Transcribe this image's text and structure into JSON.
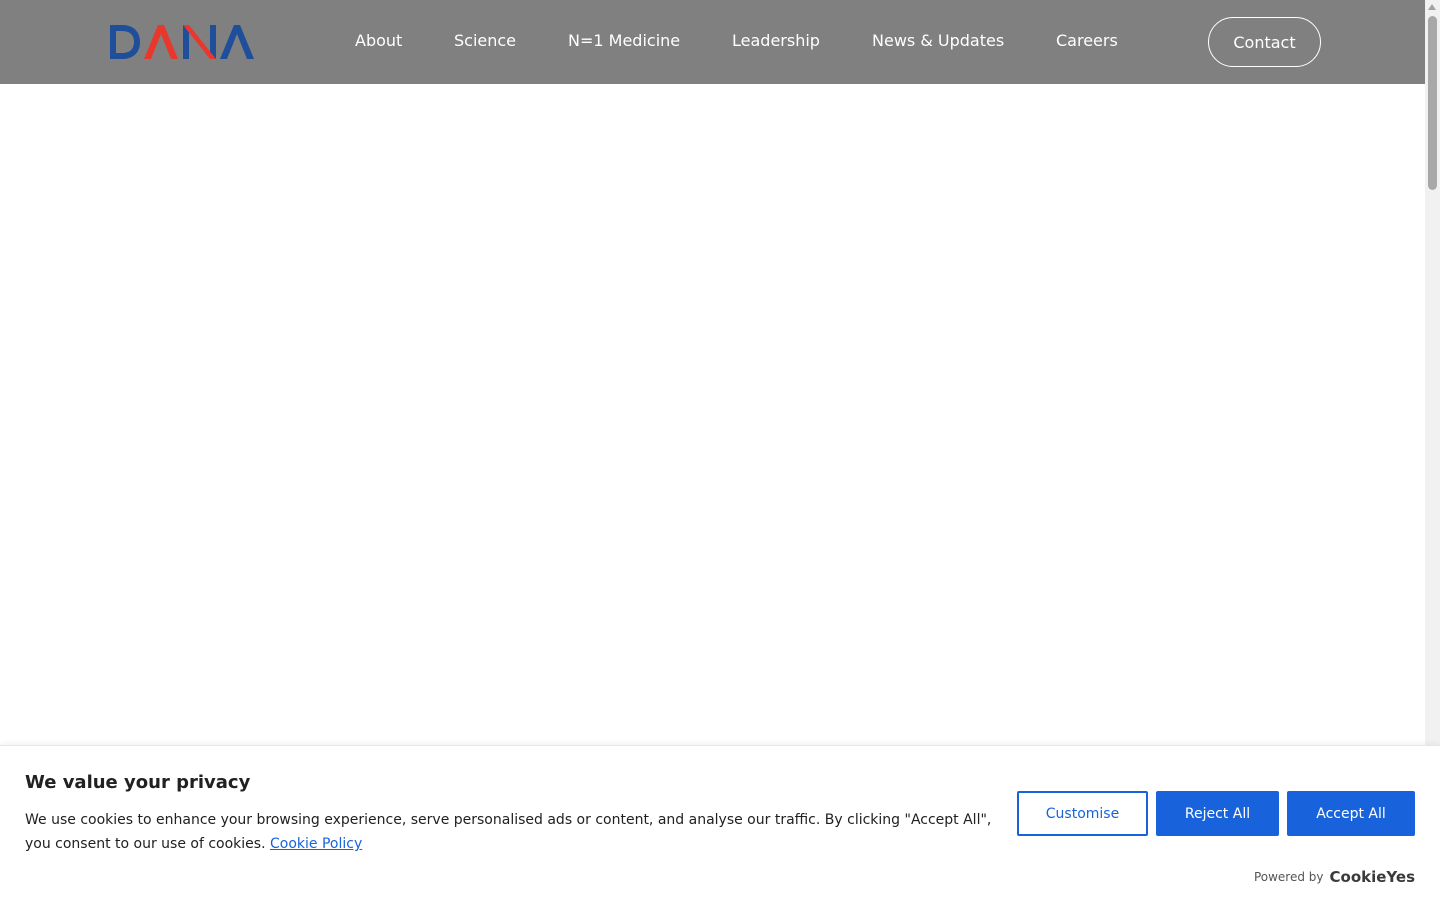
{
  "header": {
    "logo_text": "DANA",
    "nav": [
      {
        "label": "About"
      },
      {
        "label": "Science"
      },
      {
        "label": "N=1 Medicine"
      },
      {
        "label": "Leadership"
      },
      {
        "label": "News & Updates"
      },
      {
        "label": "Careers"
      }
    ],
    "contact_label": "Contact"
  },
  "colors": {
    "header_bg": "#808080",
    "logo_blue": "#1f4e9a",
    "logo_red": "#e8382e",
    "primary_button": "#1863dc"
  },
  "cookie": {
    "title": "We value your privacy",
    "text": "We use cookies to enhance your browsing experience, serve personalised ads or content, and analyse our traffic. By clicking \"Accept All\", you consent to our use of cookies.",
    "policy_link": "Cookie Policy",
    "customise_label": "Customise",
    "reject_label": "Reject All",
    "accept_label": "Accept All",
    "powered_by": "Powered by",
    "brand": "CookieYes"
  }
}
